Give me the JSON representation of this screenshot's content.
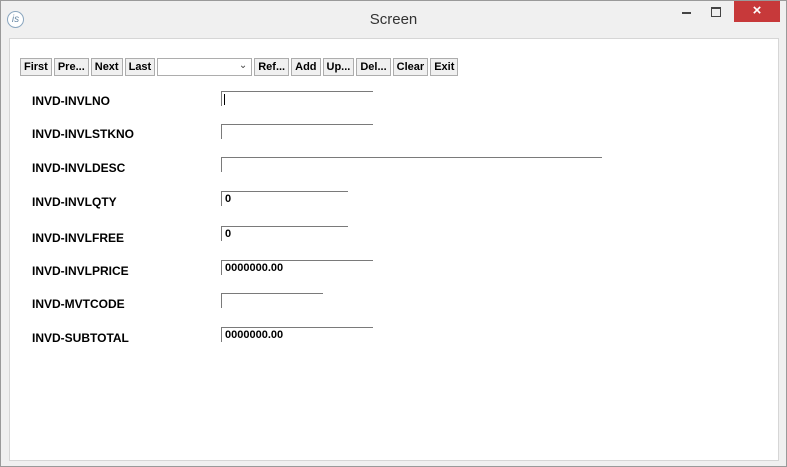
{
  "window": {
    "title": "Screen",
    "icon_text": "is",
    "controls": {
      "close": "×"
    },
    "accent_close": "#c7393a"
  },
  "toolbar": {
    "first": "First",
    "prev": "Pre...",
    "next": "Next",
    "last": "Last",
    "combo_value": "",
    "refresh": "Ref...",
    "add": "Add",
    "update": "Up...",
    "delete": "Del...",
    "clear": "Clear",
    "exit": "Exit"
  },
  "form": {
    "invlno": {
      "label": "INVD-INVLNO",
      "value": ""
    },
    "invlstkno": {
      "label": "INVD-INVLSTKNO",
      "value": ""
    },
    "invldesc": {
      "label": "INVD-INVLDESC",
      "value": ""
    },
    "invlqty": {
      "label": "INVD-INVLQTY",
      "value": "0"
    },
    "invlfree": {
      "label": "INVD-INVLFREE",
      "value": "0"
    },
    "invlprice": {
      "label": "INVD-INVLPRICE",
      "value": "0000000.00"
    },
    "mvtcode": {
      "label": "INVD-MVTCODE",
      "value": ""
    },
    "subtotal": {
      "label": "INVD-SUBTOTAL",
      "value": "0000000.00"
    }
  }
}
